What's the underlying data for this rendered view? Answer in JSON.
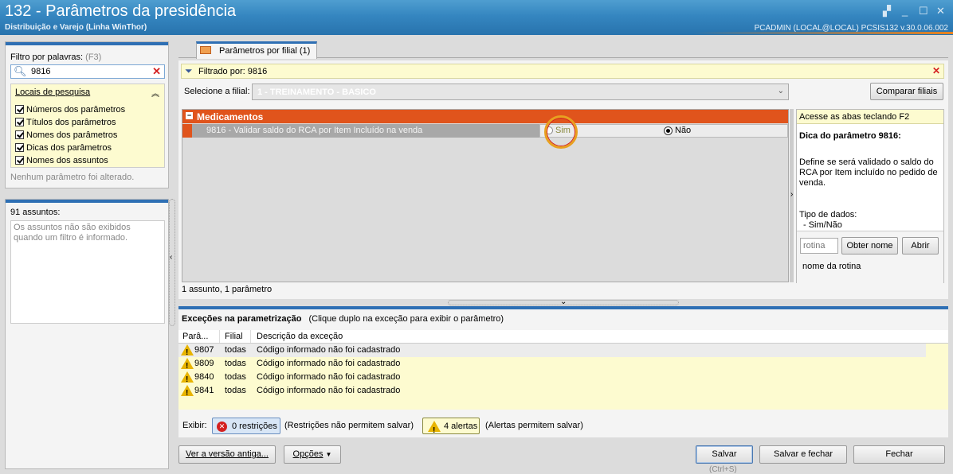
{
  "window": {
    "title": "132 - Parâmetros da presidência",
    "subtitle": "Distribuição e Varejo (Linha WinThor)",
    "session": "PCADMIN (LOCAL@LOCAL)   PCSIS132  v.30.0.06.002"
  },
  "left": {
    "filter_label": "Filtro por palavras:",
    "filter_shortcut": "(F3)",
    "filter_value": "9816",
    "locations_title": "Locais de pesquisa",
    "locations": [
      "Números dos parâmetros",
      "Títulos dos parâmetros",
      "Nomes dos parâmetros",
      "Dicas dos parâmetros",
      "Nomes dos assuntos"
    ],
    "changed_status": "Nenhum parâmetro foi alterado.",
    "subjects_count": "91 assuntos:",
    "subjects_note": "Os assuntos não são exibidos quando um filtro é informado."
  },
  "tab": {
    "label": "Parâmetros por filial",
    "count": "(1)"
  },
  "filter_bar": {
    "text": "Filtrado por: 9816"
  },
  "branch": {
    "label": "Selecione a filial:",
    "value": "1 - TREINAMENTO - BASICO",
    "compare_button": "Comparar filiais"
  },
  "grid": {
    "group": "Medicamentos",
    "param": "9816 - Validar saldo do RCA por Item Incluído na venda",
    "opt_yes": "Sim",
    "opt_no": "Não",
    "selected": "Não",
    "status": "1 assunto, 1 parâmetro"
  },
  "right_panel": {
    "hint": "Acesse as abas teclando F2",
    "tip_title": "Dica do parâmetro 9816:",
    "tip_text": "Define se será validado o saldo do RCA por Item incluído no pedido de venda.",
    "type_label": "Tipo de dados:",
    "type_value": "- Sim/Não",
    "routine_placeholder": "rotina",
    "get_name_button": "Obter nome",
    "open_button": "Abrir",
    "routine_name": "nome da rotina"
  },
  "exceptions": {
    "title": "Exceções na parametrização",
    "subtitle": "(Clique duplo na exceção para exibir o parâmetro)",
    "columns": [
      "Parâ...",
      "Filial",
      "Descrição da exceção"
    ],
    "rows": [
      {
        "param": "9807",
        "branch": "todas",
        "desc": "Código informado não foi cadastrado"
      },
      {
        "param": "9809",
        "branch": "todas",
        "desc": "Código informado não foi cadastrado"
      },
      {
        "param": "9840",
        "branch": "todas",
        "desc": "Código informado não foi cadastrado"
      },
      {
        "param": "9841",
        "branch": "todas",
        "desc": "Código informado não foi cadastrado"
      }
    ],
    "show_label": "Exibir:",
    "restrictions_button": "0 restrições",
    "restrictions_note": "(Restrições não permitem salvar)",
    "alerts_button": "4 alertas",
    "alerts_note": "(Alertas permitem salvar)"
  },
  "footer": {
    "old_version": "Ver a versão antiga...",
    "options": "Opções",
    "save": "Salvar",
    "save_shortcut": "(Ctrl+S)",
    "save_close": "Salvar e fechar",
    "close": "Fechar"
  },
  "colors": {
    "title_blue": "#3586c0",
    "group_orange": "#e0541c",
    "note_yellow": "#fdfbd0",
    "selection_blue": "#2e6fb4"
  }
}
